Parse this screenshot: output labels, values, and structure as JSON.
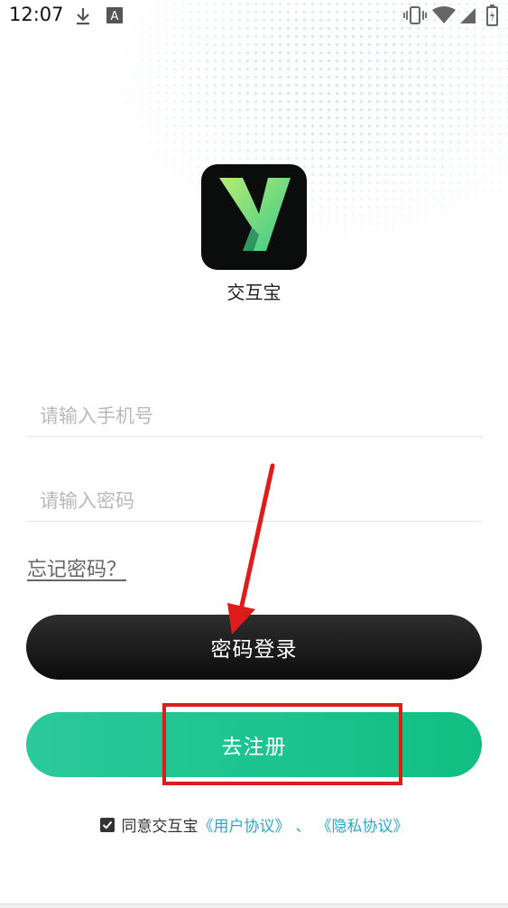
{
  "status_bar": {
    "time": "12:07",
    "icons": [
      "download-icon",
      "text-a-icon",
      "vibrate-icon",
      "wifi-icon",
      "signal-icon",
      "battery-icon"
    ]
  },
  "app": {
    "logo_letter": "Y",
    "name": "交互宝"
  },
  "form": {
    "phone_placeholder": "请输入手机号",
    "password_placeholder": "请输入密码",
    "forgot_password": "忘记密码？"
  },
  "buttons": {
    "login_label": "密码登录",
    "register_label": "去注册"
  },
  "agreement": {
    "prefix": "同意交互宝",
    "user_agreement": "《用户协议》",
    "separator": "、",
    "privacy_agreement": "《隐私协议》",
    "checked": true
  },
  "colors": {
    "login_bg": "#111111",
    "register_bg": "#18c38d",
    "link": "#2aa8c9",
    "annotation": "#e01b1b"
  }
}
